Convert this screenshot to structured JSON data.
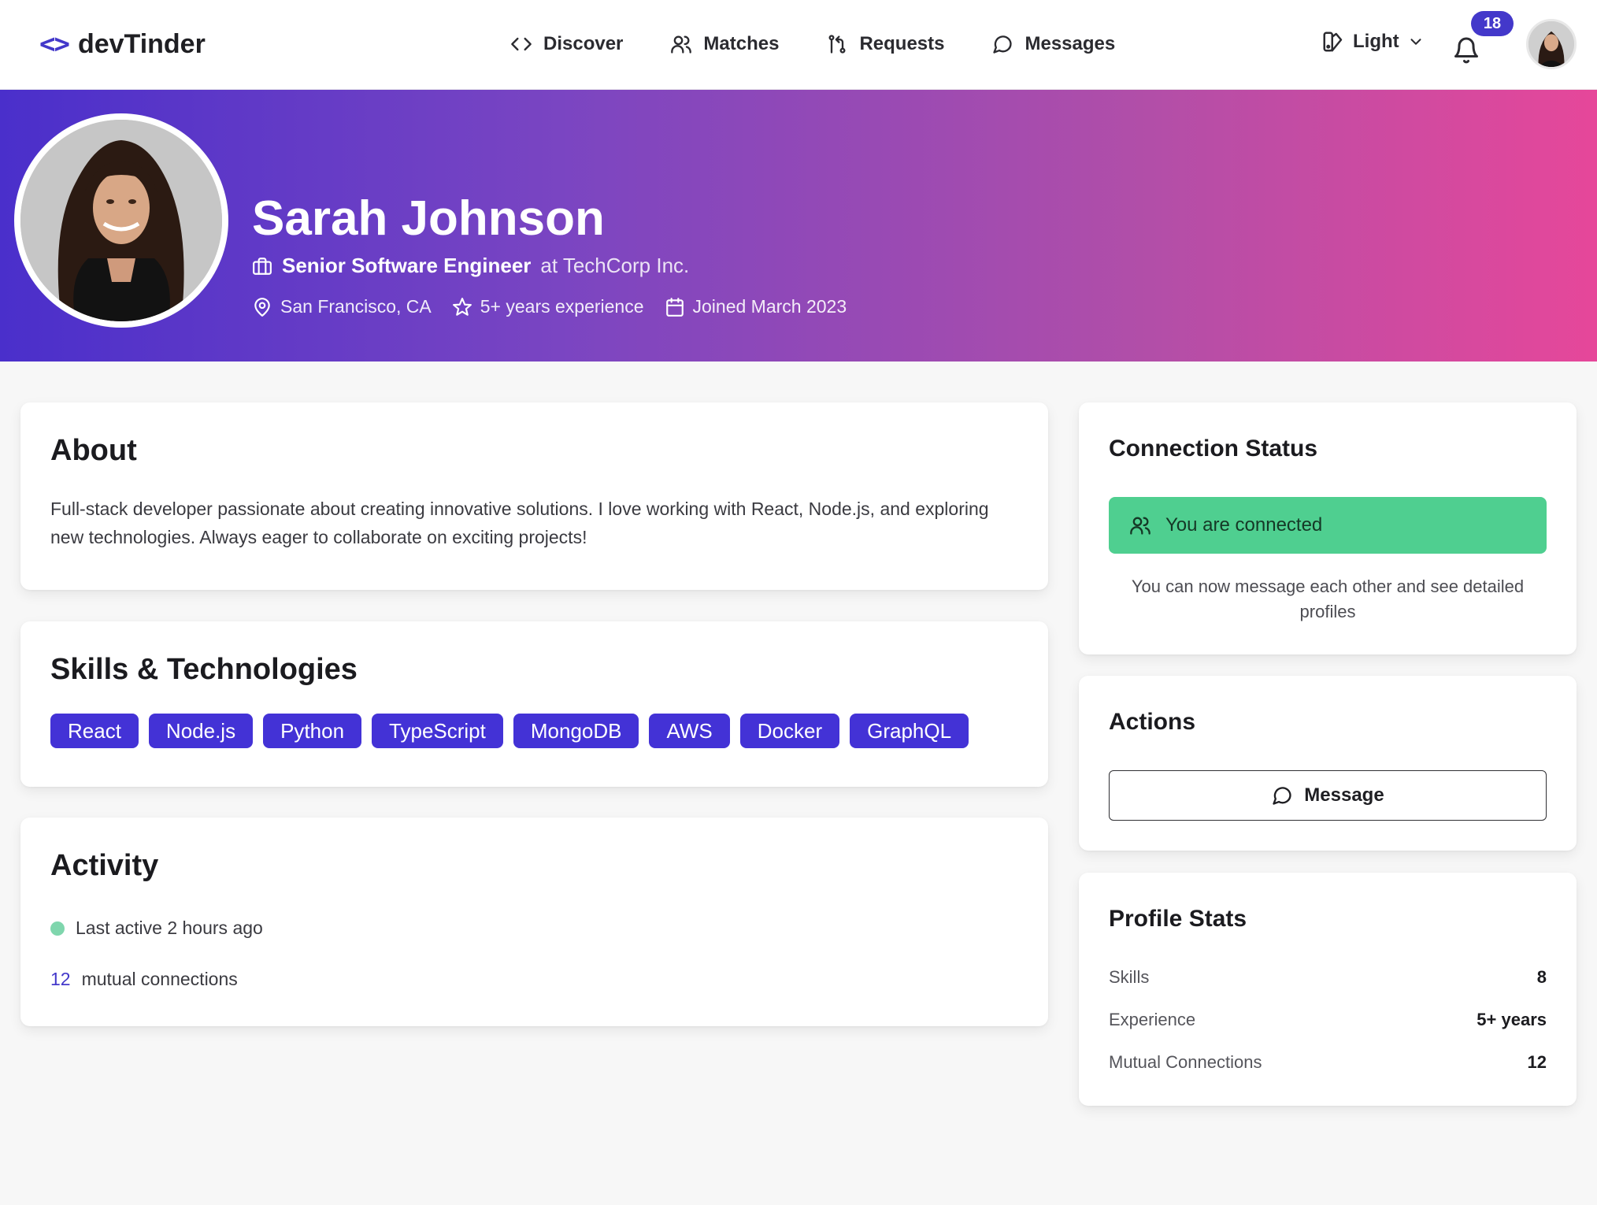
{
  "app": {
    "brand_icon": "<>",
    "brand_name": "devTinder"
  },
  "nav": {
    "items": [
      {
        "label": "Discover",
        "icon": "code-icon"
      },
      {
        "label": "Matches",
        "icon": "users-icon"
      },
      {
        "label": "Requests",
        "icon": "git-pull-request-icon"
      },
      {
        "label": "Messages",
        "icon": "message-circle-icon"
      }
    ],
    "theme_label": "Light",
    "notification_count": "18"
  },
  "profile": {
    "name": "Sarah Johnson",
    "title": "Senior Software Engineer",
    "company": "at TechCorp Inc.",
    "location": "San Francisco, CA",
    "experience": "5+ years experience",
    "joined": "Joined March 2023"
  },
  "about": {
    "heading": "About",
    "text": "Full-stack developer passionate about creating innovative solutions. I love working with React, Node.js, and exploring new technologies. Always eager to collaborate on exciting projects!"
  },
  "skills": {
    "heading": "Skills & Technologies",
    "items": [
      "React",
      "Node.js",
      "Python",
      "TypeScript",
      "MongoDB",
      "AWS",
      "Docker",
      "GraphQL"
    ]
  },
  "activity": {
    "heading": "Activity",
    "last_active": "Last active 2 hours ago",
    "mutual_count": "12",
    "mutual_label": "mutual connections"
  },
  "connection": {
    "heading": "Connection Status",
    "status": "You are connected",
    "note": "You can now message each other and see detailed profiles"
  },
  "actions": {
    "heading": "Actions",
    "message_label": "Message"
  },
  "stats": {
    "heading": "Profile Stats",
    "rows": [
      {
        "label": "Skills",
        "value": "8"
      },
      {
        "label": "Experience",
        "value": "5+ years"
      },
      {
        "label": "Mutual Connections",
        "value": "12"
      }
    ]
  },
  "colors": {
    "accent": "#4338ca",
    "connected": "#4fcf90",
    "hero_start": "#4a2fcb",
    "hero_end": "#e6479a"
  }
}
